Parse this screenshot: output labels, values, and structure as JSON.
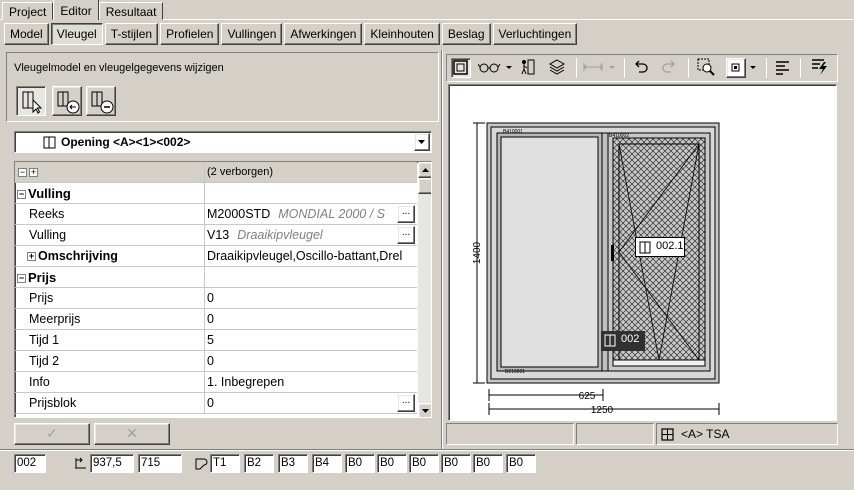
{
  "tabs": [
    {
      "label": "Project",
      "active": false
    },
    {
      "label": "Editor",
      "active": true
    },
    {
      "label": "Resultaat",
      "active": false
    }
  ],
  "subtabs": [
    {
      "label": "Model",
      "active": false
    },
    {
      "label": "Vleugel",
      "active": true
    },
    {
      "label": "T-stijlen",
      "active": false
    },
    {
      "label": "Profielen",
      "active": false
    },
    {
      "label": "Vullingen",
      "active": false
    },
    {
      "label": "Afwerkingen",
      "active": false
    },
    {
      "label": "Kleinhouten",
      "active": false
    },
    {
      "label": "Beslag",
      "active": false
    },
    {
      "label": "Verluchtingen",
      "active": false
    }
  ],
  "left": {
    "header": "Vleugelmodel en vleugelgegevens wijzigen",
    "tools": [
      "select-sash-icon",
      "add-sash-icon",
      "remove-sash-icon"
    ],
    "dropdown_value": "Opening <A><1><002>",
    "grid_header_value": "(2 verborgen)",
    "rows": [
      {
        "type": "cat",
        "name": "Vulling",
        "value": "",
        "desc": ""
      },
      {
        "type": "prop",
        "name": "Reeks",
        "value": "M2000STD",
        "desc": "MONDIAL 2000 / S",
        "ellipsis": true
      },
      {
        "type": "prop",
        "name": "Vulling",
        "value": "V13",
        "desc": "Draaikipvleugel",
        "ellipsis": true
      },
      {
        "type": "sub",
        "name": "Omschrijving",
        "value": "Draaikipvleugel,Oscillo-battant,Drel",
        "desc": ""
      },
      {
        "type": "cat",
        "name": "Prijs",
        "value": "",
        "desc": ""
      },
      {
        "type": "prop",
        "name": "Prijs",
        "value": "0",
        "desc": ""
      },
      {
        "type": "prop",
        "name": "Meerprijs",
        "value": "0",
        "desc": ""
      },
      {
        "type": "prop",
        "name": "Tijd 1",
        "value": "5",
        "desc": ""
      },
      {
        "type": "prop",
        "name": "Tijd 2",
        "value": "0",
        "desc": ""
      },
      {
        "type": "prop",
        "name": "Info",
        "value": "1. Inbegrepen",
        "desc": ""
      },
      {
        "type": "prop",
        "name": "Prijsblok",
        "value": "0",
        "desc": "",
        "ellipsis": true
      }
    ],
    "confirm_label": "✓",
    "cancel_label": "✕"
  },
  "drawing": {
    "height_label": "1400",
    "width_label": "1250",
    "sash_width_label": "625",
    "sash_label": "002.1",
    "opening_label": "002"
  },
  "status": {
    "panel3_text": "<A> TSA"
  },
  "bottom": {
    "id": "002",
    "coord_x": "937,5",
    "coord_y": "715",
    "fields": [
      "T1",
      "B2",
      "B3",
      "B4",
      "B0",
      "B0",
      "B0",
      "B0",
      "B0",
      "B0"
    ]
  }
}
